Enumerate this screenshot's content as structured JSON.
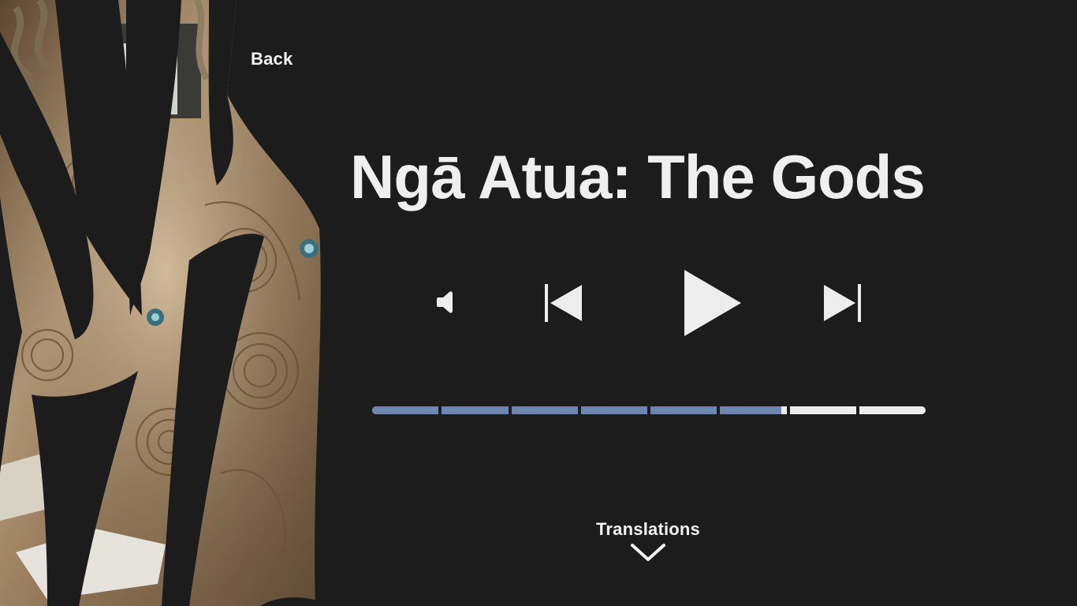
{
  "header": {
    "back_label": "Back"
  },
  "track": {
    "title": "Ngā Atua: The Gods"
  },
  "player": {
    "progress_fraction": 0.74,
    "segment_count": 8,
    "colors": {
      "played": "#6f87b0",
      "remaining": "#ececec",
      "background": "#1c1c1c",
      "text": "#f2f2f2"
    },
    "icons": {
      "volume": "volume-icon",
      "previous": "skip-previous-icon",
      "play": "play-icon",
      "next": "skip-next-icon"
    }
  },
  "footer": {
    "translations_label": "Translations",
    "toggle_icon": "chevron-down-icon"
  },
  "artwork": {
    "subject": "carved-wooden-figures-image"
  }
}
